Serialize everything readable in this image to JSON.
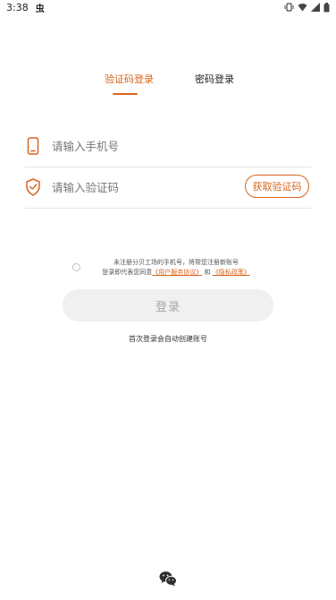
{
  "status_bar": {
    "time": "3:38",
    "app_glyph": "虫",
    "icons": [
      "vibrate-icon",
      "wifi-icon",
      "signal-icon",
      "battery-icon"
    ]
  },
  "tabs": [
    {
      "label": "验证码登录",
      "active": true
    },
    {
      "label": "密码登录",
      "active": false
    }
  ],
  "phone_field": {
    "placeholder": "请输入手机号",
    "value": "",
    "icon": "phone-icon"
  },
  "code_field": {
    "placeholder": "请输入验证码",
    "value": "",
    "icon": "shield-check-icon"
  },
  "get_code_label": "获取验证码",
  "agreement": {
    "line1": "未注册分贝工场的手机号，将帮您注册新账号",
    "line2_prefix": "登录即代表您同意",
    "terms_link": "《用户服务协议》",
    "conjunction": "和",
    "privacy_link": "《隐私政策》",
    "checked": false
  },
  "login_label": "登录",
  "auto_register_note": "首次登录会自动创建账号",
  "third_party": {
    "icon": "wechat-icon"
  },
  "colors": {
    "accent": "#d9661f",
    "disabled_button": "#f0f0f0",
    "divider": "#e6e6e6"
  }
}
